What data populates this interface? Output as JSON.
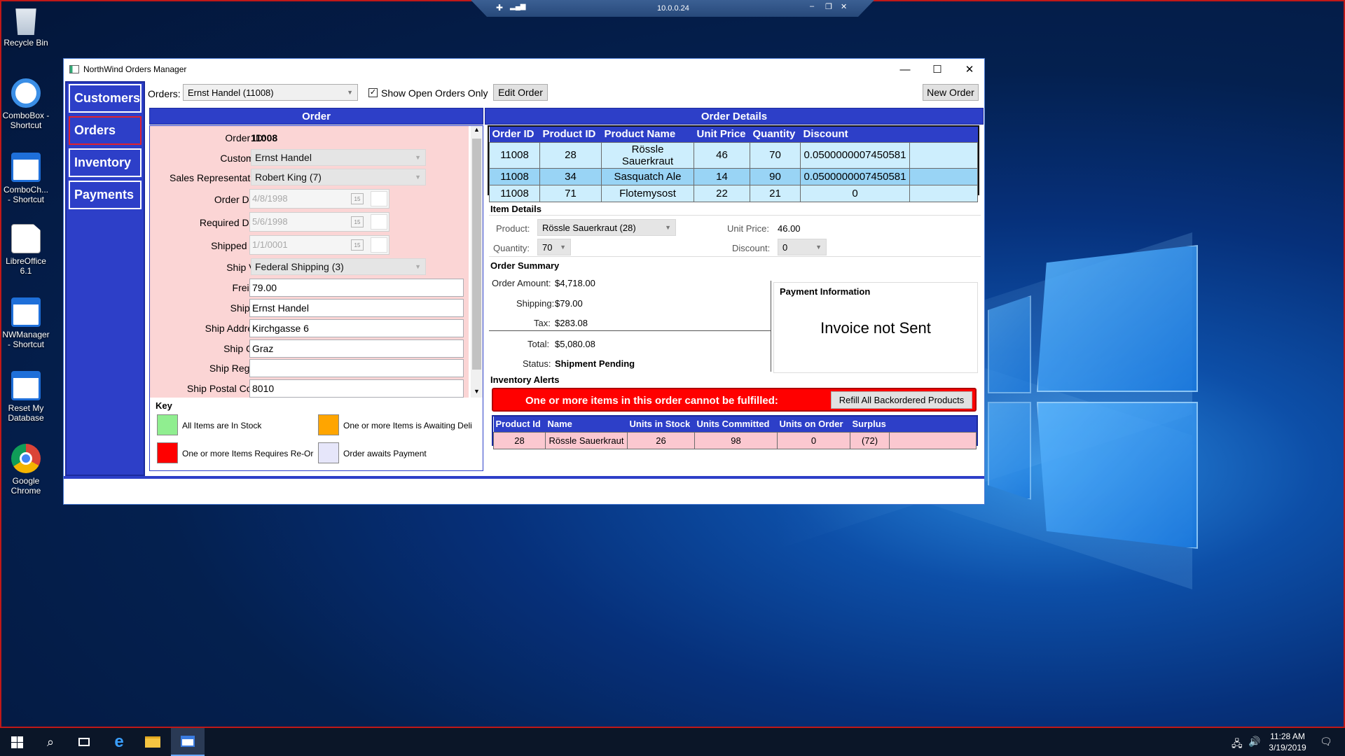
{
  "desktop": {
    "icons": [
      {
        "label": "Recycle Bin",
        "icon": "recycle-bin-icon",
        "color": "#cfd8e3"
      },
      {
        "label": "ComboBox - Shortcut",
        "icon": "internet-explorer-icon",
        "color": "#3a8ee6"
      },
      {
        "label": "ComboCh... - Shortcut",
        "icon": "app-window-icon",
        "color": "#1e6fd9"
      },
      {
        "label": "LibreOffice 6.1",
        "icon": "document-icon",
        "color": "#ffffff"
      },
      {
        "label": "NWManager - Shortcut",
        "icon": "app-window-icon",
        "color": "#1e6fd9"
      },
      {
        "label": "Reset My Database",
        "icon": "app-window-icon",
        "color": "#1e6fd9"
      },
      {
        "label": "Google Chrome",
        "icon": "chrome-icon",
        "color": "#db4437"
      }
    ]
  },
  "rdp": {
    "host": "10.0.0.24"
  },
  "window": {
    "title": "NorthWind Orders Manager"
  },
  "nav": {
    "items": [
      "Customers",
      "Orders",
      "Inventory",
      "Payments"
    ],
    "selected": "Orders"
  },
  "toolbar": {
    "orders_label": "Orders:",
    "orders_value": "Ernst Handel (11008)",
    "show_open_label": "Show Open Orders Only",
    "show_open_checked": true,
    "edit_order": "Edit Order",
    "new_order": "New Order"
  },
  "order": {
    "header": "Order",
    "fields": {
      "order_id_label": "Order ID:",
      "order_id": "11008",
      "customer_label": "Customer:",
      "customer": "Ernst Handel",
      "sales_rep_label": "Sales Representative:",
      "sales_rep": "Robert King (7)",
      "order_date_label": "Order Date:",
      "order_date": "4/8/1998",
      "required_date_label": "Required Date:",
      "required_date": "5/6/1998",
      "shipped_on_label": "Shipped On:",
      "shipped_on": "1/1/0001",
      "ship_via_label": "Ship Via:",
      "ship_via": "Federal Shipping (3)",
      "freight_label": "Freight:",
      "freight": "79.00",
      "ship_to_label": "Ship To:",
      "ship_to": "Ernst Handel",
      "ship_address_label": "Ship Address:",
      "ship_address": "Kirchgasse 6",
      "ship_city_label": "Ship City:",
      "ship_city": "Graz",
      "ship_region_label": "Ship Region:",
      "ship_region": "",
      "ship_postal_label": "Ship Postal Code:",
      "ship_postal": "8010"
    },
    "key": {
      "title": "Key",
      "items": [
        {
          "label": "All Items are In Stock",
          "color": "#90ee90"
        },
        {
          "label": "One or more Items is Awaiting Deli",
          "color": "#ffa500"
        },
        {
          "label": "One or more Items Requires Re-Orc",
          "color": "#ff0000"
        },
        {
          "label": "Order awaits Payment",
          "color": "#e6e6fa"
        }
      ]
    }
  },
  "details": {
    "header": "Order Details",
    "columns": [
      "Order ID",
      "Product ID",
      "Product Name",
      "Unit Price",
      "Quantity",
      "Discount"
    ],
    "rows": [
      [
        "11008",
        "28",
        "Rössle Sauerkraut",
        "46",
        "70",
        "0.0500000007450581"
      ],
      [
        "11008",
        "34",
        "Sasquatch Ale",
        "14",
        "90",
        "0.0500000007450581"
      ],
      [
        "11008",
        "71",
        "Flotemysost",
        "22",
        "21",
        "0"
      ]
    ],
    "row_colors": [
      "#cdeefd",
      "#99d4f5",
      "#cdeefd"
    ],
    "item_details": {
      "title": "Item Details",
      "product_label": "Product:",
      "product": "Rössle Sauerkraut (28)",
      "quantity_label": "Quantity:",
      "quantity": "70",
      "unit_price_label": "Unit Price:",
      "unit_price": "46.00",
      "discount_label": "Discount:",
      "discount": "0"
    },
    "summary": {
      "title": "Order Summary",
      "amount_label": "Order Amount:",
      "amount": "$4,718.00",
      "shipping_label": "Shipping:",
      "shipping": "$79.00",
      "tax_label": "Tax:",
      "tax": "$283.08",
      "total_label": "Total:",
      "total": "$5,080.08",
      "status_label": "Status:",
      "status": "Shipment Pending"
    },
    "payment": {
      "title": "Payment Information",
      "text": "Invoice not Sent"
    },
    "alerts": {
      "title": "Inventory Alerts",
      "message": "One or more items in this order cannot be fulfilled:",
      "refill_button": "Refill All Backordered Products",
      "columns": [
        "Product Id",
        "Name",
        "Units in Stock",
        "Units Committed",
        "Units on Order",
        "Surplus"
      ],
      "rows": [
        [
          "28",
          "Rössle Sauerkraut",
          "26",
          "98",
          "0",
          "(72)"
        ]
      ]
    }
  },
  "taskbar": {
    "time": "11:28 AM",
    "date": "3/19/2019"
  }
}
